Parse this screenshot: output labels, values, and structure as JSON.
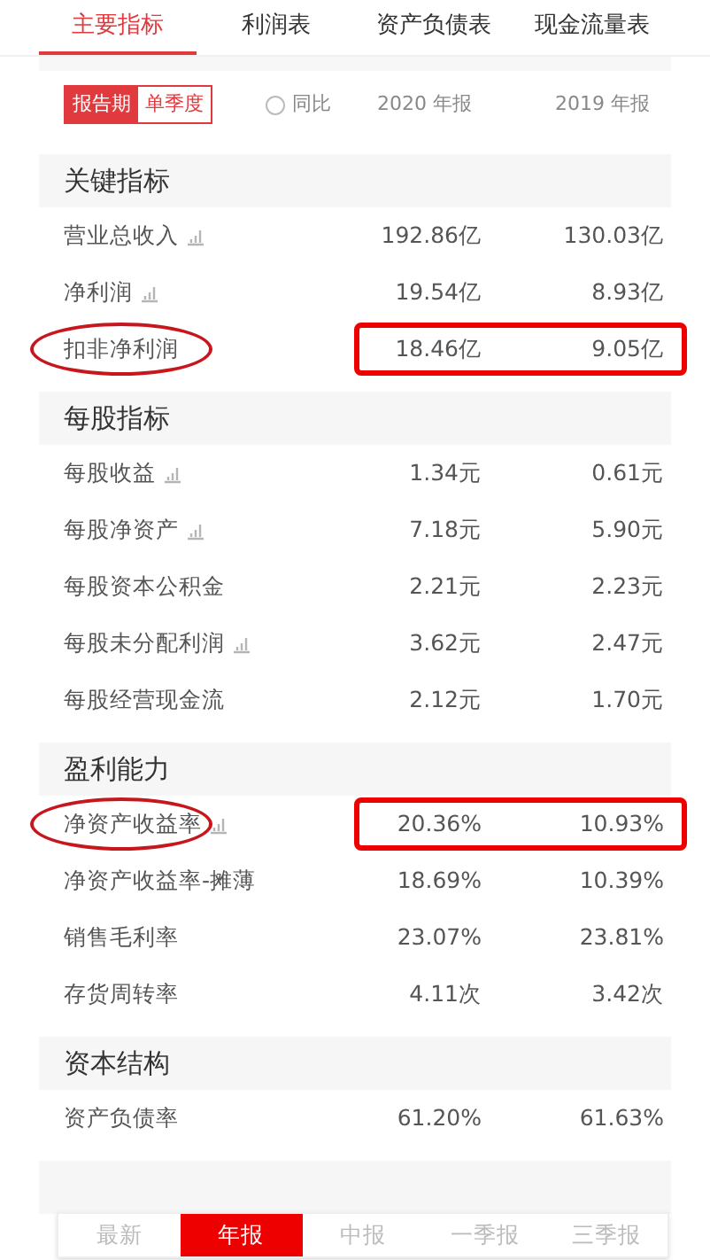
{
  "tabs": [
    {
      "label": "主要指标",
      "selected": true
    },
    {
      "label": "利润表",
      "selected": false
    },
    {
      "label": "资产负债表",
      "selected": false
    },
    {
      "label": "现金流量表",
      "selected": false
    }
  ],
  "period_toggle": [
    {
      "label": "报告期",
      "selected": true
    },
    {
      "label": "单季度",
      "selected": false
    }
  ],
  "yoy": {
    "label": "同比",
    "checked": false
  },
  "columns": [
    "2020 年报",
    "2019 年报"
  ],
  "sections": [
    {
      "title": "关键指标",
      "rows": [
        {
          "label": "营业总收入",
          "chart": true,
          "circled": false,
          "boxed": false,
          "values": [
            "192.86亿",
            "130.03亿"
          ]
        },
        {
          "label": "净利润",
          "chart": true,
          "circled": false,
          "boxed": false,
          "values": [
            "19.54亿",
            "8.93亿"
          ]
        },
        {
          "label": "扣非净利润",
          "chart": false,
          "circled": true,
          "boxed": true,
          "values": [
            "18.46亿",
            "9.05亿"
          ]
        }
      ]
    },
    {
      "title": "每股指标",
      "rows": [
        {
          "label": "每股收益",
          "chart": true,
          "circled": false,
          "boxed": false,
          "values": [
            "1.34元",
            "0.61元"
          ]
        },
        {
          "label": "每股净资产",
          "chart": true,
          "circled": false,
          "boxed": false,
          "values": [
            "7.18元",
            "5.90元"
          ]
        },
        {
          "label": "每股资本公积金",
          "chart": false,
          "circled": false,
          "boxed": false,
          "values": [
            "2.21元",
            "2.23元"
          ]
        },
        {
          "label": "每股未分配利润",
          "chart": true,
          "circled": false,
          "boxed": false,
          "values": [
            "3.62元",
            "2.47元"
          ]
        },
        {
          "label": "每股经营现金流",
          "chart": false,
          "circled": false,
          "boxed": false,
          "values": [
            "2.12元",
            "1.70元"
          ]
        }
      ]
    },
    {
      "title": "盈利能力",
      "rows": [
        {
          "label": "净资产收益率",
          "chart": true,
          "circled": true,
          "boxed": true,
          "values": [
            "20.36%",
            "10.93%"
          ]
        },
        {
          "label": "净资产收益率-摊薄",
          "chart": false,
          "circled": false,
          "boxed": false,
          "values": [
            "18.69%",
            "10.39%"
          ]
        },
        {
          "label": "销售毛利率",
          "chart": false,
          "circled": false,
          "boxed": false,
          "values": [
            "23.07%",
            "23.81%"
          ]
        },
        {
          "label": "存货周转率",
          "chart": false,
          "circled": false,
          "boxed": false,
          "values": [
            "4.11次",
            "3.42次"
          ]
        }
      ]
    },
    {
      "title": "资本结构",
      "rows": [
        {
          "label": "资产负债率",
          "chart": false,
          "circled": false,
          "boxed": false,
          "values": [
            "61.20%",
            "61.63%"
          ]
        }
      ]
    }
  ],
  "report_types": [
    {
      "label": "最新",
      "selected": false
    },
    {
      "label": "年报",
      "selected": true
    },
    {
      "label": "中报",
      "selected": false
    },
    {
      "label": "一季报",
      "selected": false
    },
    {
      "label": "三季报",
      "selected": false
    }
  ]
}
